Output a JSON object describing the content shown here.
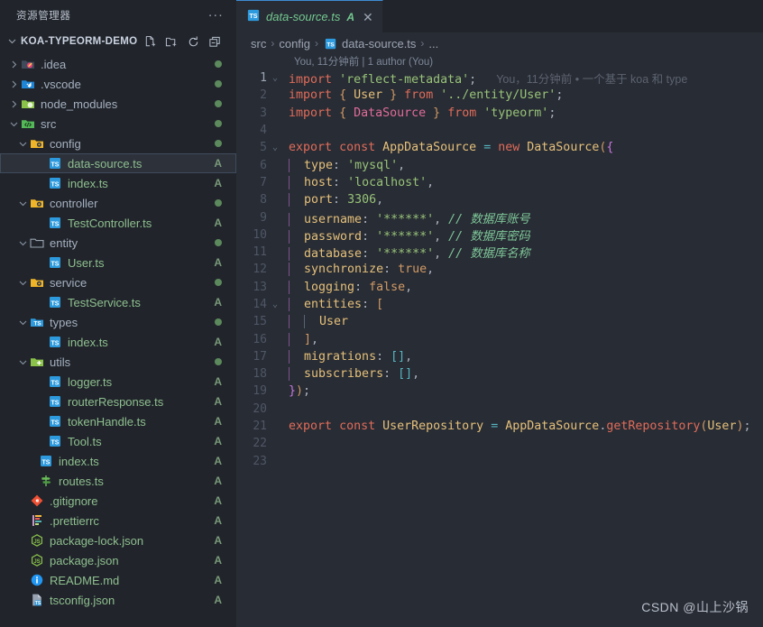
{
  "sidebar": {
    "header_title": "资源管理器",
    "overflow_label": "...",
    "project": {
      "name": "KOA-TYPEORM-DEMO",
      "actions": [
        "new-file",
        "new-folder",
        "refresh-explorer",
        "collapse-folders"
      ]
    },
    "items": [
      {
        "name": ".idea",
        "kind": "folder",
        "icon": "folder-idea",
        "indent": 1,
        "expanded": false,
        "status": "dot",
        "dim": false
      },
      {
        "name": ".vscode",
        "kind": "folder",
        "icon": "folder-vscode",
        "indent": 1,
        "expanded": false,
        "status": "dot",
        "dim": false
      },
      {
        "name": "node_modules",
        "kind": "folder",
        "icon": "folder-node",
        "indent": 1,
        "expanded": false,
        "status": "dot",
        "dim": true
      },
      {
        "name": "src",
        "kind": "folder",
        "icon": "folder-src",
        "indent": 1,
        "expanded": true,
        "status": "dot",
        "dim": false
      },
      {
        "name": "config",
        "kind": "folder",
        "icon": "folder-config",
        "indent": 2,
        "expanded": true,
        "status": "dot",
        "dim": false
      },
      {
        "name": "data-source.ts",
        "kind": "file",
        "icon": "ts-file",
        "indent": 4,
        "expanded": null,
        "status": "A",
        "dim": false,
        "selected": true
      },
      {
        "name": "index.ts",
        "kind": "file",
        "icon": "ts-file",
        "indent": 4,
        "expanded": null,
        "status": "A",
        "dim": false
      },
      {
        "name": "controller",
        "kind": "folder",
        "icon": "folder-config",
        "indent": 2,
        "expanded": true,
        "status": "dot",
        "dim": false
      },
      {
        "name": "TestController.ts",
        "kind": "file",
        "icon": "ts-file",
        "indent": 4,
        "expanded": null,
        "status": "A",
        "dim": false
      },
      {
        "name": "entity",
        "kind": "folder",
        "icon": "folder-plain",
        "indent": 2,
        "expanded": true,
        "status": "dot",
        "dim": false
      },
      {
        "name": "User.ts",
        "kind": "file",
        "icon": "ts-file",
        "indent": 4,
        "expanded": null,
        "status": "A",
        "dim": false
      },
      {
        "name": "service",
        "kind": "folder",
        "icon": "folder-config",
        "indent": 2,
        "expanded": true,
        "status": "dot",
        "dim": false
      },
      {
        "name": "TestService.ts",
        "kind": "file",
        "icon": "ts-file",
        "indent": 4,
        "expanded": null,
        "status": "A",
        "dim": false
      },
      {
        "name": "types",
        "kind": "folder",
        "icon": "folder-types",
        "indent": 2,
        "expanded": true,
        "status": "dot",
        "dim": false
      },
      {
        "name": "index.ts",
        "kind": "file",
        "icon": "ts-file",
        "indent": 4,
        "expanded": null,
        "status": "A",
        "dim": false
      },
      {
        "name": "utils",
        "kind": "folder",
        "icon": "folder-utils",
        "indent": 2,
        "expanded": true,
        "status": "dot",
        "dim": false
      },
      {
        "name": "logger.ts",
        "kind": "file",
        "icon": "ts-file",
        "indent": 4,
        "expanded": null,
        "status": "A",
        "dim": false
      },
      {
        "name": "routerResponse.ts",
        "kind": "file",
        "icon": "ts-file",
        "indent": 4,
        "expanded": null,
        "status": "A",
        "dim": false
      },
      {
        "name": "tokenHandle.ts",
        "kind": "file",
        "icon": "ts-file",
        "indent": 4,
        "expanded": null,
        "status": "A",
        "dim": false
      },
      {
        "name": "Tool.ts",
        "kind": "file",
        "icon": "ts-file",
        "indent": 4,
        "expanded": null,
        "status": "A",
        "dim": false
      },
      {
        "name": "index.ts",
        "kind": "file",
        "icon": "ts-file",
        "indent": 3,
        "expanded": null,
        "status": "A",
        "dim": false
      },
      {
        "name": "routes.ts",
        "kind": "file",
        "icon": "routes-file",
        "indent": 3,
        "expanded": null,
        "status": "A",
        "dim": false
      },
      {
        "name": ".gitignore",
        "kind": "file",
        "icon": "git-file",
        "indent": 2,
        "expanded": null,
        "status": "A",
        "dim": false
      },
      {
        "name": ".prettierrc",
        "kind": "file",
        "icon": "prettier-file",
        "indent": 2,
        "expanded": null,
        "status": "A",
        "dim": false
      },
      {
        "name": "package-lock.json",
        "kind": "file",
        "icon": "node-json-file",
        "indent": 2,
        "expanded": null,
        "status": "A",
        "dim": false
      },
      {
        "name": "package.json",
        "kind": "file",
        "icon": "node-json-file",
        "indent": 2,
        "expanded": null,
        "status": "A",
        "dim": false
      },
      {
        "name": "README.md",
        "kind": "file",
        "icon": "info-file",
        "indent": 2,
        "expanded": null,
        "status": "A",
        "dim": false
      },
      {
        "name": "tsconfig.json",
        "kind": "file",
        "icon": "tsconfig-file",
        "indent": 2,
        "expanded": null,
        "status": "A",
        "dim": false
      }
    ]
  },
  "editor": {
    "tab": {
      "label": "data-source.ts",
      "badge": "A",
      "close_label": "✕",
      "icon": "ts-file"
    },
    "breadcrumb": [
      "src",
      "config",
      "data-source.ts",
      "..."
    ],
    "blame_summary": "You, 11分钟前 | 1 author (You)",
    "inline_blame": "You，11分钟前 • 一个基于 koa 和 type",
    "lines": [
      {
        "n": 1,
        "fold": "v"
      },
      {
        "n": 2,
        "fold": ""
      },
      {
        "n": 3,
        "fold": ""
      },
      {
        "n": 4,
        "fold": ""
      },
      {
        "n": 5,
        "fold": "v"
      },
      {
        "n": 6,
        "fold": ""
      },
      {
        "n": 7,
        "fold": ""
      },
      {
        "n": 8,
        "fold": ""
      },
      {
        "n": 9,
        "fold": ""
      },
      {
        "n": 10,
        "fold": ""
      },
      {
        "n": 11,
        "fold": ""
      },
      {
        "n": 12,
        "fold": ""
      },
      {
        "n": 13,
        "fold": ""
      },
      {
        "n": 14,
        "fold": "v"
      },
      {
        "n": 15,
        "fold": ""
      },
      {
        "n": 16,
        "fold": ""
      },
      {
        "n": 17,
        "fold": ""
      },
      {
        "n": 18,
        "fold": ""
      },
      {
        "n": 19,
        "fold": ""
      },
      {
        "n": 20,
        "fold": ""
      },
      {
        "n": 21,
        "fold": ""
      },
      {
        "n": 22,
        "fold": ""
      },
      {
        "n": 23,
        "fold": ""
      }
    ],
    "code_text": [
      "import 'reflect-metadata';",
      "import { User } from '../entity/User';",
      "import { DataSource } from 'typeorm';",
      "",
      "export const AppDataSource = new DataSource({",
      "  type: 'mysql',",
      "  host: 'localhost',",
      "  port: 3306,",
      "  username: '******', // 数据库账号",
      "  password: '******', // 数据库密码",
      "  database: '******', // 数据库名称",
      "  synchronize: true,",
      "  logging: false,",
      "  entities: [",
      "    User",
      "  ],",
      "  migrations: [],",
      "  subscribers: [],",
      "});",
      "",
      "export const UserRepository = AppDataSource.getRepository(User);",
      "",
      ""
    ],
    "tokens": {
      "comment_username": "// 数据库账号",
      "comment_password": "// 数据库密码",
      "comment_database": "// 数据库名称",
      "secret_value": "'******'",
      "type_value": "'mysql'",
      "host_value": "'localhost'",
      "port_value": "3306",
      "synchronize_value": "true",
      "logging_value": "false"
    }
  },
  "watermark": "CSDN @山上沙锅",
  "colors": {
    "sidebar_bg": "#21252b",
    "editor_bg": "#282c34",
    "selection_bg": "#2c313a",
    "tab_active_border": "#3f8cd4",
    "added_green": "#73c991",
    "string_green": "#98c379",
    "keyword_purple": "#c678dd",
    "keyword_orange": "#e06c5a",
    "property_yellow": "#e5c07b",
    "number_orange": "#d19a66",
    "comment_green": "#7ec699",
    "linenum_gray": "#4f5666"
  }
}
